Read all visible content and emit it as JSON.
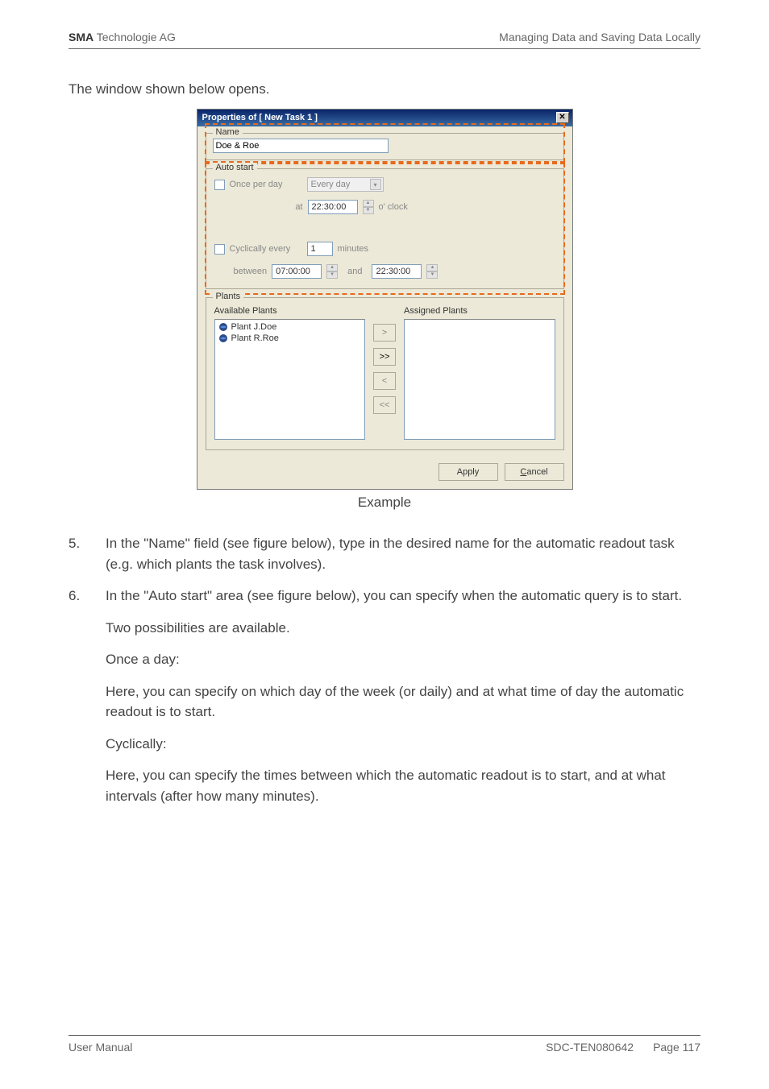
{
  "header": {
    "company_bold": "SMA",
    "company_rest": " Technologie AG",
    "section": "Managing Data and Saving Data Locally"
  },
  "intro": "The window shown below opens.",
  "dialog": {
    "title": "Properties of [ New Task 1 ]",
    "close": "✕",
    "name_group": "Name",
    "name_value": "Doe & Roe",
    "auto_group": "Auto start",
    "once_label": "Once per day",
    "every_day": "Every day",
    "at_label": "at",
    "at_time": "22:30:00",
    "oclock": "o' clock",
    "cyc_label": "Cyclically every",
    "cyc_val": "1",
    "minutes": "minutes",
    "between": "between",
    "bt_time1": "07:00:00",
    "and": "and",
    "bt_time2": "22:30:00",
    "plants_group": "Plants",
    "avail": "Available Plants",
    "assigned": "Assigned Plants",
    "plant1": "Plant J.Doe",
    "plant2": "Plant R.Roe",
    "mv1": ">",
    "mv2": ">>",
    "mv3": "<",
    "mv4": "<<",
    "apply": "Apply",
    "cancel": "Cancel"
  },
  "caption": "Example",
  "steps": {
    "n5": "5.",
    "t5": "In the \"Name\" field (see figure below), type in the desired name for the automatic readout task (e.g. which plants the task involves).",
    "n6": "6.",
    "t6": "In the \"Auto start\" area (see figure below), you can specify when the automatic query is to start.",
    "p1": "Two possibilities are available.",
    "h1": "Once a day:",
    "p2": "Here, you can specify on which day of the week (or daily) and at what time of day the automatic readout is to start.",
    "h2": "Cyclically:",
    "p3": "Here, you can specify the times between which the automatic readout is to start, and at what intervals (after how many minutes)."
  },
  "footer": {
    "left": "User Manual",
    "doc": "SDC-TEN080642",
    "page_label": "Page ",
    "page_num": "117"
  }
}
